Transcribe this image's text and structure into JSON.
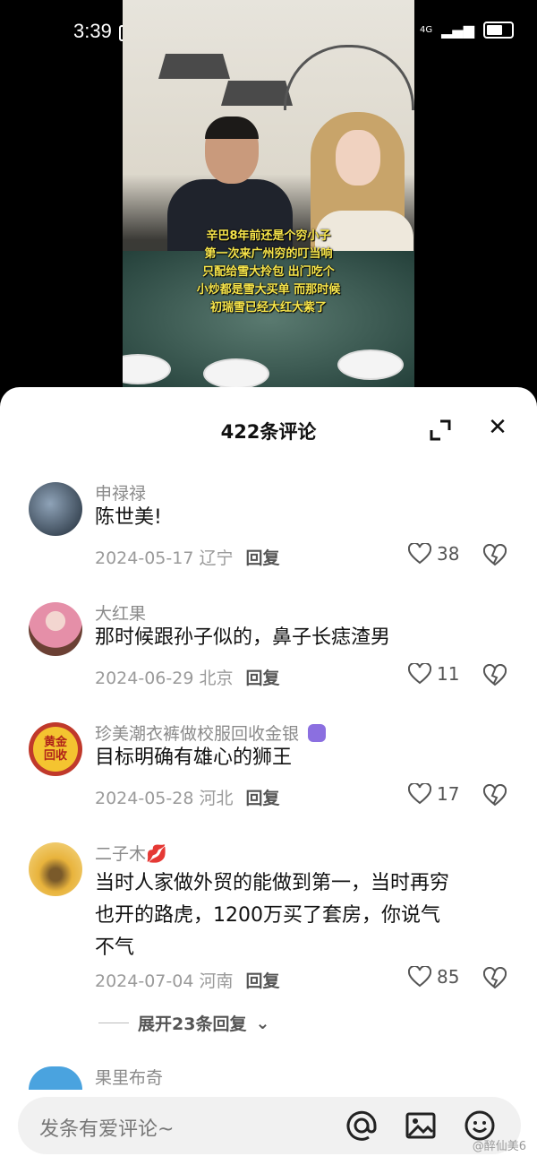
{
  "status": {
    "time": "3:39",
    "network": "4G"
  },
  "video": {
    "subtitle_lines": [
      "辛巴8年前还是个穷小子",
      "第一次来广州穷的叮当响",
      "只配给雪大拎包 出门吃个",
      "小炒都是雪大买单 而那时候",
      "初瑞雪已经大红大紫了"
    ]
  },
  "comments_sheet": {
    "title": "422条评论",
    "comments": [
      {
        "username": "申禄禄",
        "text_lines": [
          "陈世美!"
        ],
        "date_location": "2024-05-17 辽宁",
        "reply_label": "回复",
        "likes": "38",
        "avatar_icon": "car-interior-avatar"
      },
      {
        "username": "大红果",
        "text_lines": [
          "那时候跟孙子似的，鼻子长痣渣男"
        ],
        "date_location": "2024-06-29 北京",
        "reply_label": "回复",
        "likes": "11",
        "avatar_icon": "girl-portrait-avatar"
      },
      {
        "username": "珍美潮衣裤做校服回收金银",
        "avatar_text": [
          "黄金",
          "回收"
        ],
        "text_lines": [
          "目标明确有雄心的狮王"
        ],
        "date_location": "2024-05-28 河北",
        "reply_label": "回复",
        "likes": "17",
        "badge_icon": "purple-badge-icon",
        "avatar_icon": "gold-recycle-avatar"
      },
      {
        "username": "二子木",
        "username_emoji": "💋",
        "text_lines": [
          "当时人家做外贸的能做到第一，当时再穷",
          "也开的路虎，1200万买了套房，你说气",
          "不气"
        ],
        "date_location": "2024-07-04 河南",
        "reply_label": "回复",
        "likes": "85",
        "avatar_icon": "golden-tree-avatar"
      },
      {
        "username": "果里布奇",
        "avatar_icon": "blue-avatar"
      }
    ],
    "expand_replies": "展开23条回复"
  },
  "input_bar": {
    "placeholder": "发条有爱评论~"
  },
  "watermark": "@醉仙美6",
  "colors": {
    "subtitle": "#f7e54a",
    "meta_gray": "#9a9a9a",
    "badge_purple": "#8b6fe0"
  }
}
